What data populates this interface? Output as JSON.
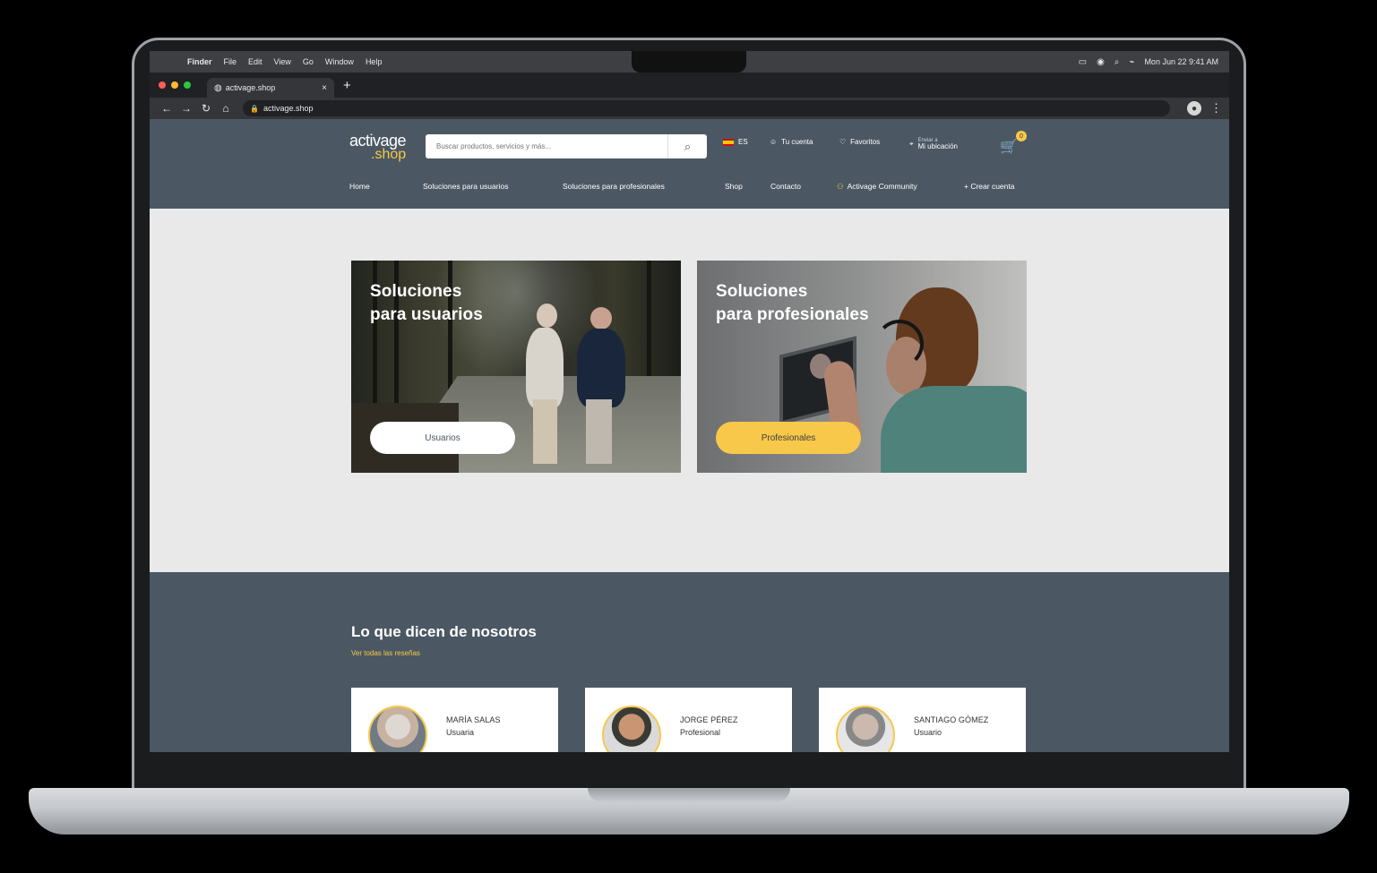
{
  "mac_menu": {
    "app": "Finder",
    "items": [
      "File",
      "Edit",
      "View",
      "Go",
      "Window",
      "Help"
    ],
    "status_time": "Mon Jun 22  9:41 AM"
  },
  "browser": {
    "tab_title": "activage.shop",
    "tab_close": "×",
    "new_tab": "+",
    "url": "activage.shop"
  },
  "site": {
    "logo_top": "activage",
    "logo_bottom": ".shop",
    "search_placeholder": "Buscar productos, servicios y más...",
    "language": "ES",
    "account": "Tu cuenta",
    "favorites": "Favoritos",
    "location_small": "Enviar a",
    "location": "Mi ubicación",
    "cart_count": "0",
    "nav": {
      "home": "Home",
      "users": "Soluciones para usuarios",
      "professionals": "Soluciones para profesionales",
      "shop": "Shop",
      "contact": "Contacto",
      "community": "Activage Community",
      "create_account": "+ Crear cuenta"
    }
  },
  "hero": {
    "user_title_1": "Soluciones",
    "user_title_2": "para usuarios",
    "user_button": "Usuarios",
    "pro_title_1": "Soluciones",
    "pro_title_2": "para profesionales",
    "pro_button": "Profesionales"
  },
  "testimonials": {
    "title": "Lo que dicen de nosotros",
    "link": "Ver todas las reseñas",
    "reviews": [
      {
        "name": "MARÍA SALAS",
        "role": "Usuaria"
      },
      {
        "name": "JORGE PÉREZ",
        "role": "Profesional"
      },
      {
        "name": "SANTIAGO GÓMEZ",
        "role": "Usuario"
      }
    ]
  },
  "colors": {
    "header": "#4b5863",
    "accent": "#f7c84a",
    "hero_bg": "#e9e9e9"
  },
  "icons": {
    "search": "search-icon",
    "cart": "cart-icon",
    "heart": "heart-icon",
    "location": "location-pin-icon",
    "account": "account-icon",
    "community": "community-icon"
  }
}
